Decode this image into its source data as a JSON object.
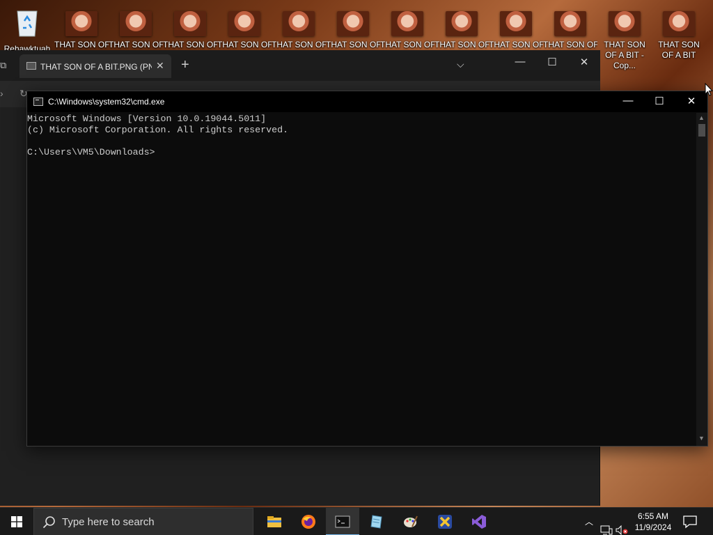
{
  "desktop": {
    "icons": [
      {
        "label": "Rehawktuah"
      },
      {
        "label": "THAT SON OF"
      },
      {
        "label": "THAT SON OF"
      },
      {
        "label": "THAT SON OF"
      },
      {
        "label": "THAT SON OF"
      },
      {
        "label": "THAT SON OF"
      },
      {
        "label": "THAT SON OF"
      },
      {
        "label": "THAT SON OF"
      },
      {
        "label": "THAT SON OF"
      },
      {
        "label": "THAT SON OF"
      },
      {
        "label": "THAT SON OF"
      },
      {
        "label": "THAT SON OF A BIT - Cop..."
      },
      {
        "label": "THAT SON OF A BIT"
      }
    ]
  },
  "photos": {
    "tab_title": "THAT SON OF A BIT.PNG (PNG",
    "tab_close": "✕",
    "new_tab": "+"
  },
  "cmd": {
    "title": "C:\\Windows\\system32\\cmd.exe",
    "lines": [
      "Microsoft Windows [Version 10.0.19044.5011]",
      "(c) Microsoft Corporation. All rights reserved.",
      "",
      "C:\\Users\\VM5\\Downloads>"
    ]
  },
  "taskbar": {
    "search_placeholder": "Type here to search",
    "apps": [
      "file-explorer-icon",
      "firefox-icon",
      "command-prompt-icon",
      "notepad-icon",
      "paint-icon",
      "xampp-icon",
      "visual-studio-icon"
    ],
    "time": "6:55 AM",
    "date": "11/9/2024"
  },
  "colors": {
    "console_bg": "#0c0c0c",
    "console_text": "#cccccc",
    "taskbar_bg": "#1a1a1a",
    "active_indicator": "#76b9ed"
  }
}
